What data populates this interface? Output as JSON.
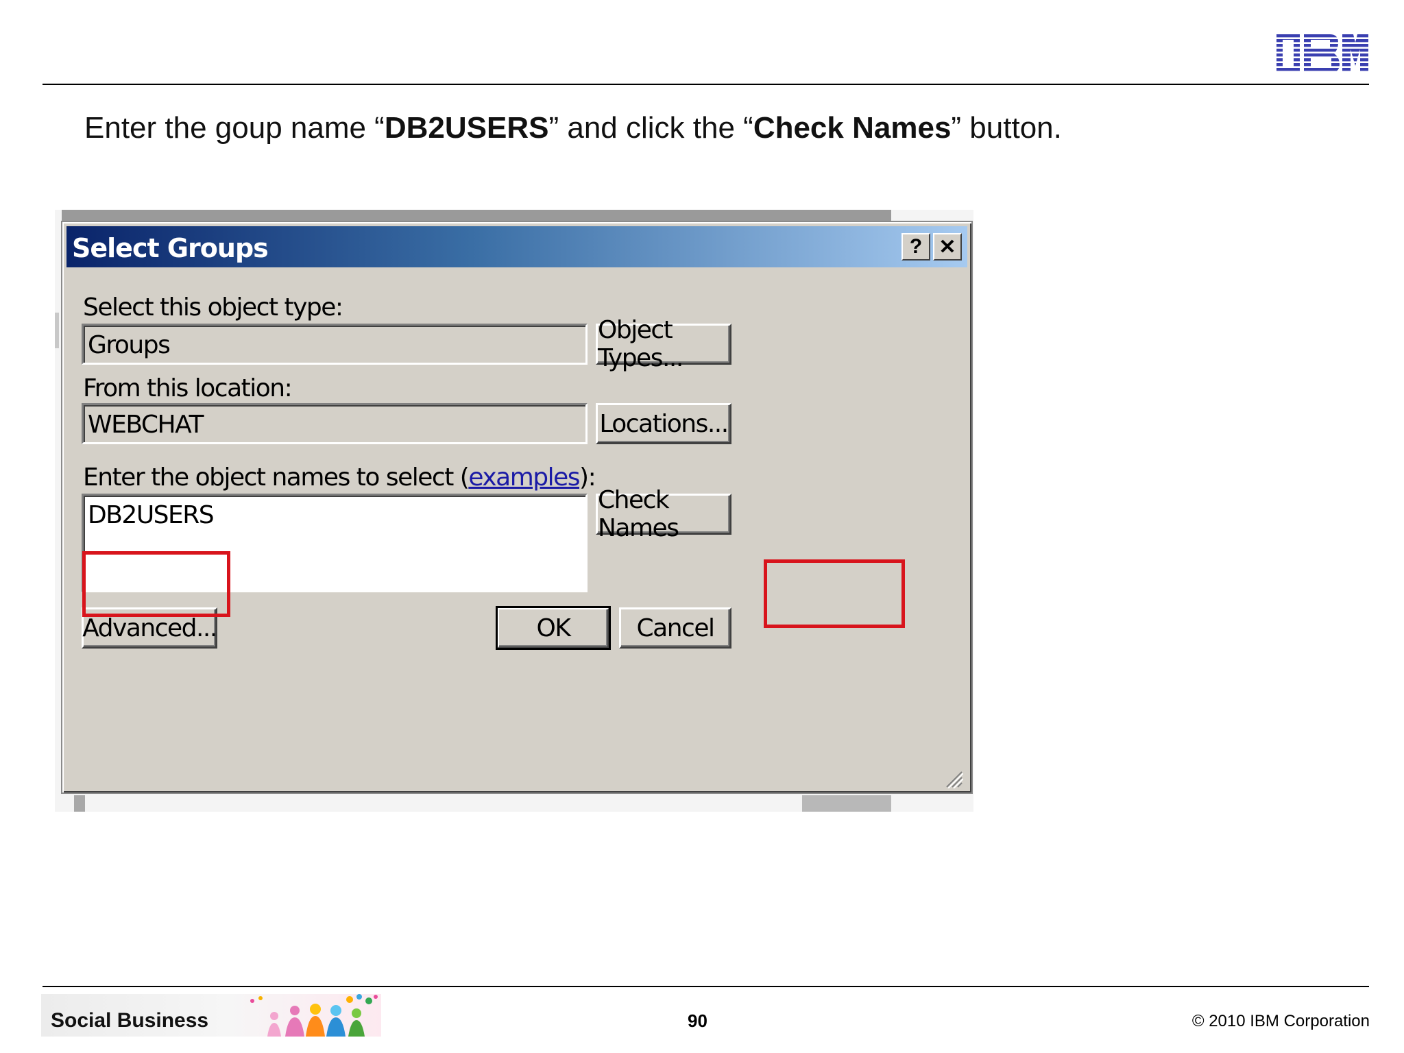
{
  "slide": {
    "logo": "IBM",
    "instruction": {
      "before": "Enter the goup name “",
      "group": "DB2USERS",
      "middle": "” and click the “",
      "button": "Check Names",
      "after": "” button."
    },
    "footer": {
      "banner": "Social Business",
      "page": "90",
      "copyright": "© 2010 IBM Corporation"
    }
  },
  "dialog": {
    "title": "Select Groups",
    "help_label": "?",
    "close_label": "✕",
    "object_type_label": "Select this object type:",
    "object_type_value": "Groups",
    "object_types_button": "Object Types...",
    "location_label": "From this location:",
    "location_value": "WEBCHAT",
    "locations_button": "Locations...",
    "names_label_prefix": "Enter the object names to select (",
    "names_label_link": "examples",
    "names_label_suffix": "):",
    "names_value": "DB2USERS",
    "check_names_button": "Check Names",
    "advanced_button": "Advanced...",
    "ok_button": "OK",
    "cancel_button": "Cancel"
  },
  "colors": {
    "highlight": "#d8141c",
    "ibm_blue": "#2f34a8",
    "title_gradient_start": "#0a246a",
    "title_gradient_end": "#a6caf0"
  }
}
